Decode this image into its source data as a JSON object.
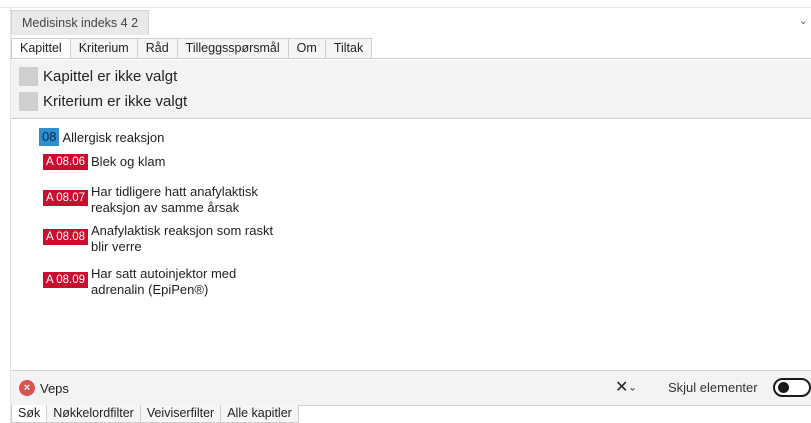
{
  "window": {
    "tab_title": "Medisinsk indeks 4 2"
  },
  "tabs": [
    {
      "label": "Kapittel"
    },
    {
      "label": "Kriterium"
    },
    {
      "label": "Råd"
    },
    {
      "label": "Tilleggsspørsmål"
    },
    {
      "label": "Om"
    },
    {
      "label": "Tiltak"
    }
  ],
  "selection": {
    "chapter_status": "Kapittel er ikke valgt",
    "criterion_status": "Kriterium er ikke valgt"
  },
  "chapter": {
    "number": "08",
    "title": "Allergisk reaksjon"
  },
  "criteria": [
    {
      "code": "A 08.06",
      "text": "Blek og klam"
    },
    {
      "code": "A 08.07",
      "text": "Har tidligere hatt anafylaktisk reaksjon av samme årsak"
    },
    {
      "code": "A 08.08",
      "text": "Anafylaktisk reaksjon som raskt blir verre"
    },
    {
      "code": "A 08.09",
      "text": "Har satt autoinjektor med adrenalin (EpiPen®)"
    }
  ],
  "search": {
    "chip_label": "Veps",
    "clear_symbol": "✕",
    "toggle_label": "Skjul elementer",
    "toggle_on": false
  },
  "bottom_tabs": [
    {
      "label": "Søk"
    },
    {
      "label": "Nøkkelordfilter"
    },
    {
      "label": "Veiviserfilter"
    },
    {
      "label": "Alle kapitler"
    }
  ],
  "colors": {
    "criterion_code_bg": "#c8102e",
    "chapter_num_bg": "#2f8fd0",
    "chip_icon": "#d9534f"
  }
}
